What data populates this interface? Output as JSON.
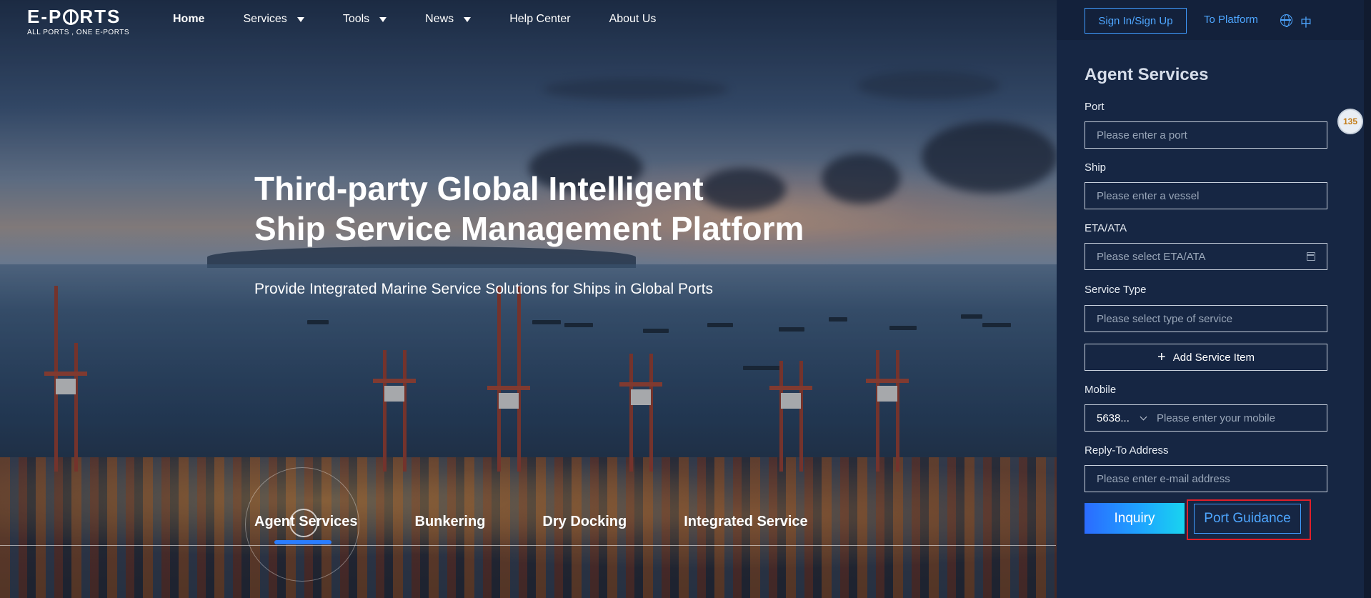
{
  "brand": {
    "name_left": "E-P",
    "name_right": "RTS",
    "tagline": "ALL PORTS , ONE E-PORTS"
  },
  "nav": {
    "items": [
      {
        "label": "Home",
        "active": true,
        "dropdown": false
      },
      {
        "label": "Services",
        "active": false,
        "dropdown": true
      },
      {
        "label": "Tools",
        "active": false,
        "dropdown": true
      },
      {
        "label": "News",
        "active": false,
        "dropdown": true
      },
      {
        "label": "Help Center",
        "active": false,
        "dropdown": false
      },
      {
        "label": "About Us",
        "active": false,
        "dropdown": false
      }
    ]
  },
  "hero": {
    "headline_line1": "Third-party Global Intelligent",
    "headline_line2": "Ship Service Management Platform",
    "subline": "Provide Integrated Marine Service Solutions for Ships in Global Ports",
    "tabs": [
      "Agent Services",
      "Bunkering",
      "Dry Docking",
      "Integrated Service"
    ],
    "active_tab": "Agent Services"
  },
  "header_right": {
    "signin": "Sign In/Sign Up",
    "to_platform": "To Platform",
    "lang": "中"
  },
  "form": {
    "title": "Agent Services",
    "port_label": "Port",
    "port_placeholder": "Please enter a port",
    "ship_label": "Ship",
    "ship_placeholder": "Please enter a vessel",
    "eta_label": "ETA/ATA",
    "eta_placeholder": "Please select ETA/ATA",
    "service_type_label": "Service Type",
    "service_type_placeholder": "Please select type of service",
    "add_service": "Add Service Item",
    "mobile_label": "Mobile",
    "mobile_code": "5638...",
    "mobile_placeholder": "Please enter your mobile",
    "reply_label": "Reply-To Address",
    "reply_placeholder": "Please enter e-mail address",
    "inquiry": "Inquiry",
    "port_guidance": "Port Guidance"
  },
  "side_badge": "135",
  "colors": {
    "accent": "#4ea6ff",
    "panel": "#162643",
    "highlight": "#e0202a"
  }
}
